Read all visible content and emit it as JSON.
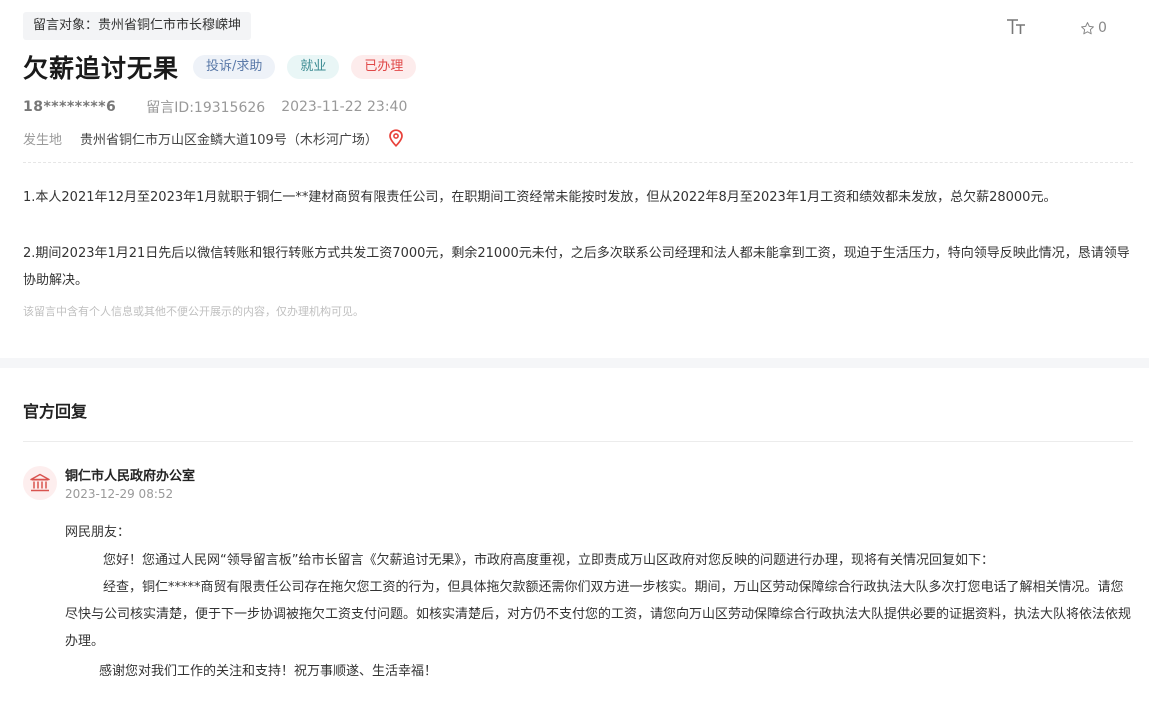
{
  "message": {
    "target": "留言对象：贵州省铜仁市市长穆嵘坤",
    "favorite_count": "0",
    "title": "欠薪追讨无果",
    "badges": {
      "type": "投诉/求助",
      "field": "就业",
      "status": "已办理"
    },
    "user": "18********6",
    "message_id": "留言ID:19315626",
    "datetime": "2023-11-22 23:40",
    "location_label": "发生地",
    "location": "贵州省铜仁市万山区金鳞大道109号（木杉河广场）",
    "paragraphs": [
      "1.本人2021年12月至2023年1月就职于铜仁一**建材商贸有限责任公司，在职期间工资经常未能按时发放，但从2022年8月至2023年1月工资和绩效都未发放，总欠薪28000元。",
      "2.期间2023年1月21日先后以微信转账和银行转账方式共发工资7000元，剩余21000元未付，之后多次联系公司经理和法人都未能拿到工资，现迫于生活压力，特向领导反映此情况，恳请领导协助解决。"
    ],
    "privacy_note": "该留言中含有个人信息或其他不便公开展示的内容，仅办理机构可见。"
  },
  "reply": {
    "heading": "官方回复",
    "org": "铜仁市人民政府办公室",
    "time": "2023-12-29 08:52",
    "greeting": "网民朋友：",
    "paragraphs": [
      "您好！您通过人民网“领导留言板”给市长留言《欠薪追讨无果》，市政府高度重视，立即责成万山区政府对您反映的问题进行办理，现将有关情况回复如下：",
      "经查，铜仁*****商贸有限责任公司存在拖欠您工资的行为，但具体拖欠款额还需你们双方进一步核实。期间，万山区劳动保障综合行政执法大队多次打您电话了解相关情况。请您尽快与公司核实清楚，便于下一步协调被拖欠工资支付问题。如核实清楚后，对方仍不支付您的工资，请您向万山区劳动保障综合行政执法大队提供必要的证据资料，执法大队将依法依规办理。",
      "感谢您对我们工作的关注和支持！祝万事顺遂、生活幸福！"
    ]
  },
  "icons": {
    "font_size": "font-size-icon",
    "star": "star-outline-icon",
    "pin": "location-pin-icon",
    "org": "government-building-icon"
  },
  "colors": {
    "status_red": "#e04848",
    "pin_red": "#e8413a",
    "type_blue": "#5b7aa9",
    "field_teal": "#3b8b92",
    "org_icon": "#d9534f"
  }
}
